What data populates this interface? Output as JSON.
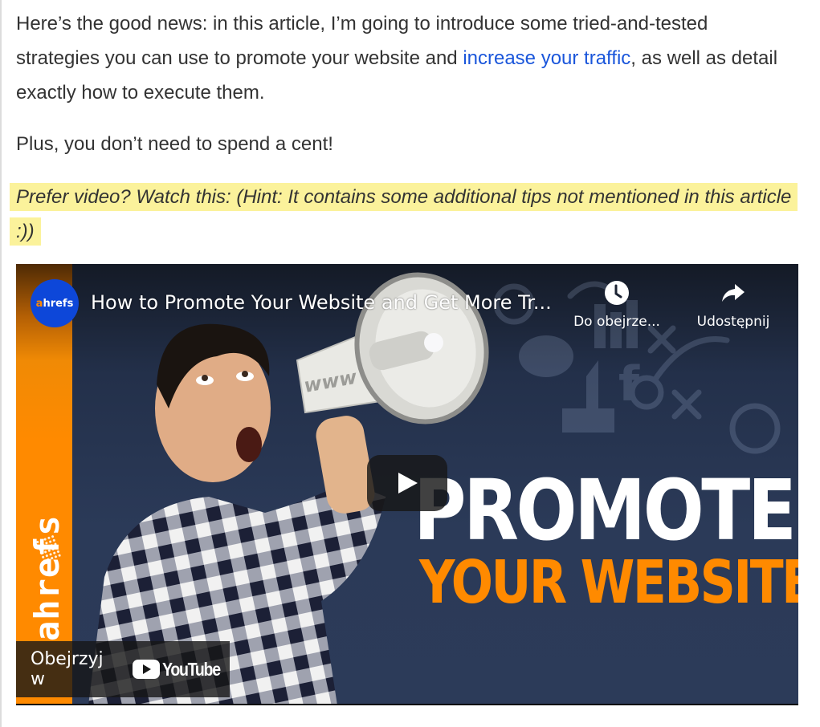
{
  "article": {
    "paragraph1": {
      "before_link": "Here’s the good news: in this article, I’m going to introduce some tried-and-tested strategies you can use to promote your website and ",
      "link_text": "increase your traffic",
      "after_link": ", as well as detail exactly how to execute them."
    },
    "paragraph2": "Plus, you don’t need to spend a cent!",
    "highlight_note": "Prefer video? Watch this: (Hint: It contains some additional tips not mentioned in this article :))"
  },
  "video": {
    "channel_logo_text_accent": "a",
    "channel_logo_text_rest": "hrefs",
    "title": "How to Promote Your Website and Get More Tr...",
    "watch_later_label": "Do obejrze...",
    "share_label": "Udostępnij",
    "side_brand": "ahrefs",
    "thumbnail_headline_1": "PROMOTE",
    "thumbnail_headline_2": "YOUR WEBSITE",
    "megaphone_text": "www",
    "watch_on_label": "Obejrzyj w",
    "youtube_wordmark": "YouTube",
    "icons": {
      "watch_later": "clock-icon",
      "share": "share-arrow-icon",
      "play": "play-icon",
      "youtube": "youtube-logo-icon"
    }
  },
  "colors": {
    "link": "#1a56db",
    "highlight": "#fbf29b",
    "brand_orange": "#ff8a00",
    "channel_blue": "#0d47d9",
    "thumbnail_navy": "#2c3b59"
  }
}
